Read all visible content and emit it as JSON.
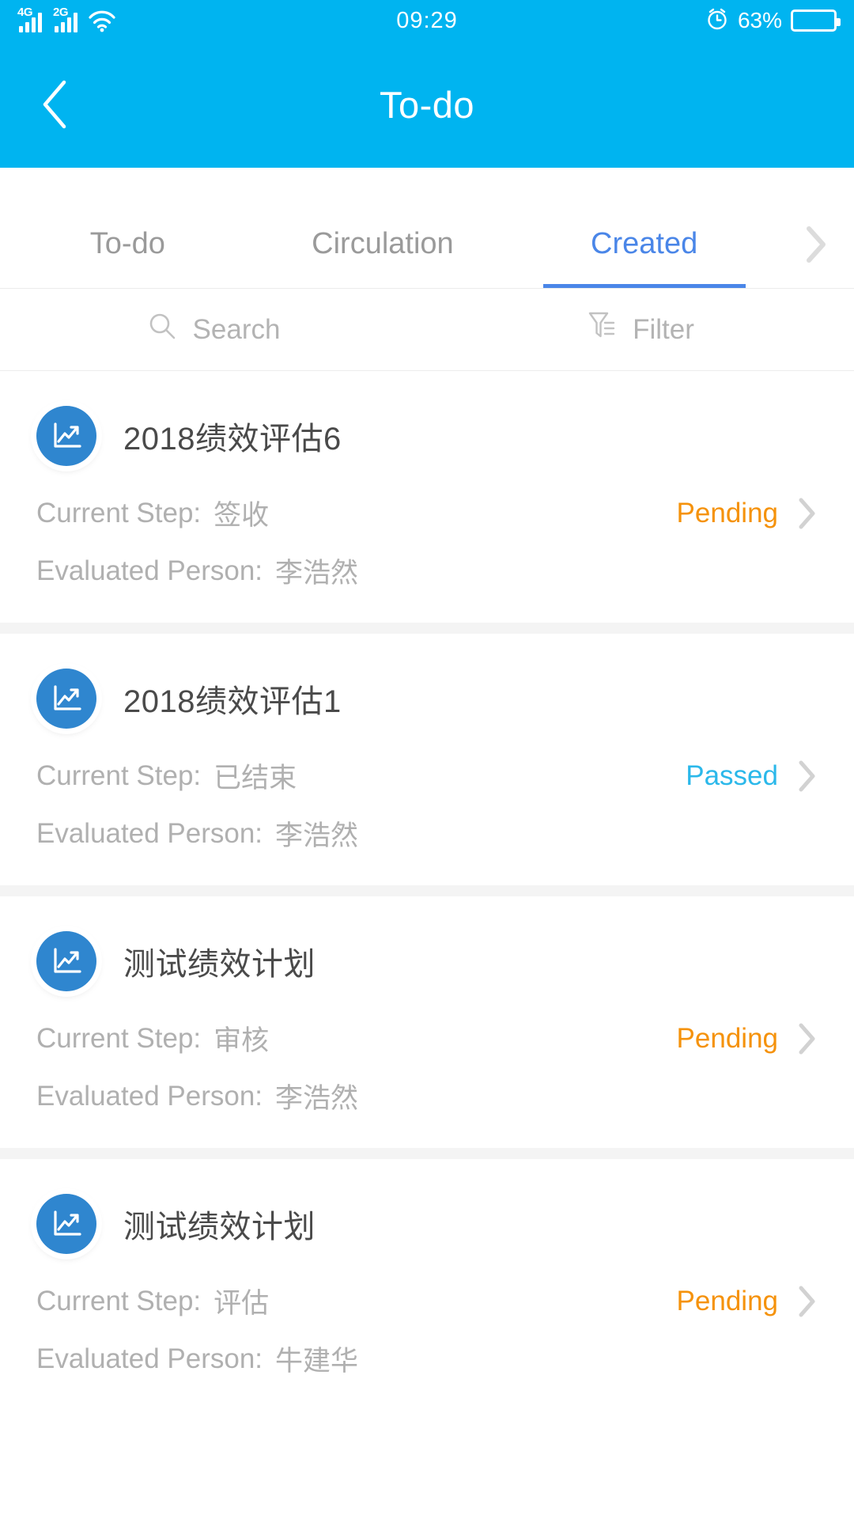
{
  "statusbar": {
    "signal1_label": "4G",
    "signal2_label": "2G",
    "wifi_icon": "wifi-icon",
    "time": "09:29",
    "alarm_icon": "alarm-clock-icon",
    "battery_percent": "63%",
    "battery_level": 63
  },
  "header": {
    "back_icon": "back-chevron-icon",
    "title": "To-do"
  },
  "tabs": {
    "items": [
      {
        "label": "To-do",
        "active": false
      },
      {
        "label": "Circulation",
        "active": false
      },
      {
        "label": "Created",
        "active": true
      }
    ],
    "more_icon": "chevron-right-icon"
  },
  "searchbar": {
    "search_icon": "search-icon",
    "search_placeholder": "Search",
    "filter_icon": "filter-icon",
    "filter_label": "Filter"
  },
  "labels": {
    "current_step": "Current Step:",
    "evaluated_person": "Evaluated Person:"
  },
  "colors": {
    "brand_cyan": "#00B4F0",
    "tab_active_blue": "#4A86E8",
    "status_pending": "#F5920B",
    "status_passed": "#2BB8EA",
    "avatar_blue": "#2F86CF"
  },
  "list": {
    "items": [
      {
        "icon": "chart-trend-icon",
        "title": "2018绩效评估6",
        "current_step": "签收",
        "evaluated_person": "李浩然",
        "status": "Pending",
        "status_type": "pending",
        "chevron_icon": "chevron-right-icon"
      },
      {
        "icon": "chart-trend-icon",
        "title": "2018绩效评估1",
        "current_step": "已结束",
        "evaluated_person": "李浩然",
        "status": "Passed",
        "status_type": "passed",
        "chevron_icon": "chevron-right-icon"
      },
      {
        "icon": "chart-trend-icon",
        "title": "测试绩效计划",
        "current_step": "审核",
        "evaluated_person": "李浩然",
        "status": "Pending",
        "status_type": "pending",
        "chevron_icon": "chevron-right-icon"
      },
      {
        "icon": "chart-trend-icon",
        "title": "测试绩效计划",
        "current_step": "评估",
        "evaluated_person": "牛建华",
        "status": "Pending",
        "status_type": "pending",
        "chevron_icon": "chevron-right-icon"
      }
    ]
  }
}
